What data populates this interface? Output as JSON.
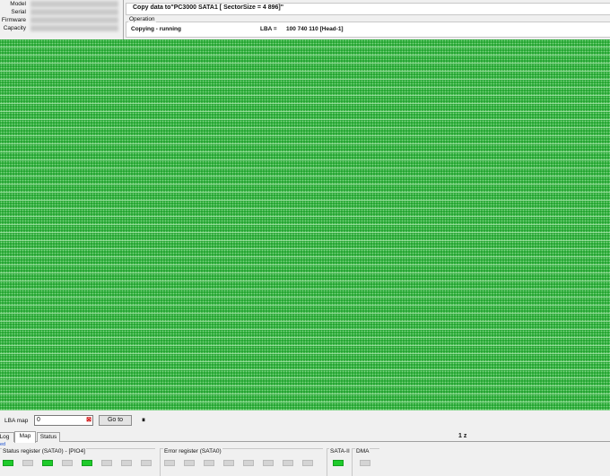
{
  "drive_info": {
    "model_label": "Model",
    "serial_label": "Serial",
    "firmware_label": "Firmware",
    "capacity_label": "Capacity"
  },
  "action": {
    "text": "Copy data to\"PC3000 SATA1 [ SectorSize = 4 896]\""
  },
  "operation": {
    "title": "Operation",
    "status": "Copying - running",
    "lba_label": "LBA =",
    "lba_value": "100 740 110  [Head-1]"
  },
  "controls": {
    "lba_map_label": "LBA map",
    "lba_value": "0",
    "clear_glyph": "⊠",
    "goto_label": "Go to",
    "pause_glyph": "⏸"
  },
  "tabs": [
    {
      "label": "Log",
      "active": false
    },
    {
      "label": "Map",
      "active": true
    },
    {
      "label": "Status",
      "active": false
    }
  ],
  "right_mark": "1 z",
  "registers": {
    "top_label": "ed",
    "status_title": "Status register (SATA0) - [PIO4]",
    "status_leds": [
      true,
      false,
      true,
      false,
      true,
      false,
      false,
      false
    ],
    "error_title": "Error register (SATA0)",
    "error_leds": [
      false,
      false,
      false,
      false,
      false,
      false,
      false,
      false
    ],
    "sata_title": "SATA-II",
    "sata_leds": [
      true
    ],
    "dma_title": "DMA",
    "dma_leds": [
      false
    ],
    "led_on_color": "#1fcb2b",
    "led_off_color": "#d4d4d4"
  },
  "colors": {
    "map_green": "#24a531"
  }
}
